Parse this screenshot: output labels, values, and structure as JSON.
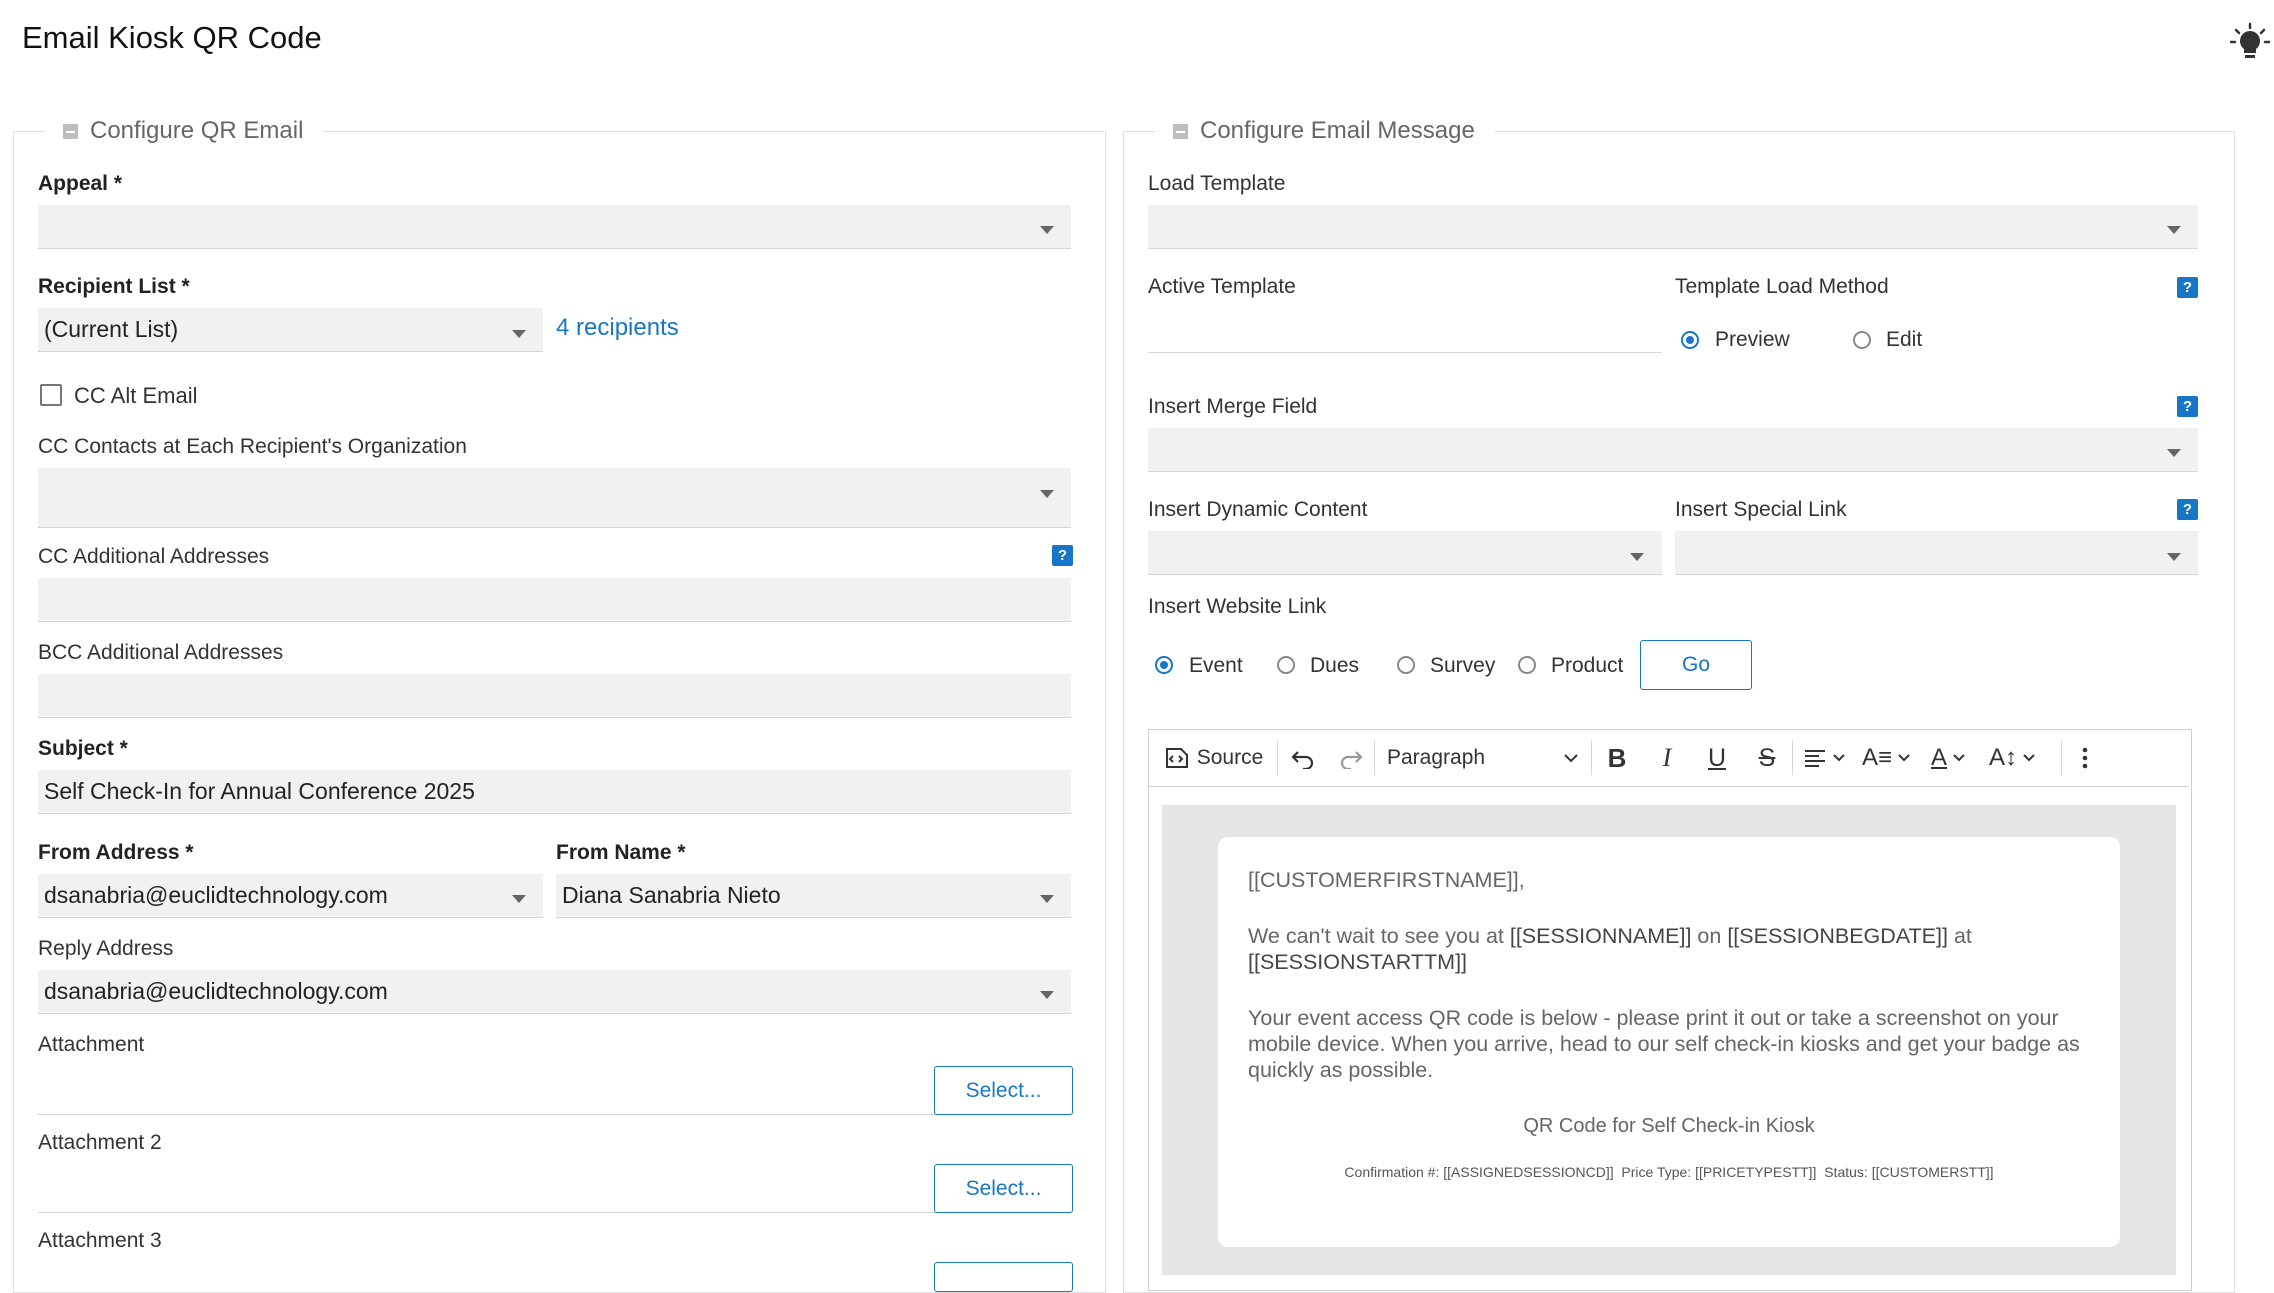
{
  "page": {
    "title": "Email Kiosk QR Code",
    "hint_icon": "lightbulb-icon"
  },
  "left": {
    "section_title": "Configure QR Email",
    "appeal": {
      "label": "Appeal *",
      "value": ""
    },
    "recipient_list": {
      "label": "Recipient List *",
      "value": "(Current List)",
      "recipients_link": "4 recipients"
    },
    "cc_alt_email": {
      "label": "CC Alt Email",
      "checked": false
    },
    "cc_contacts": {
      "label": "CC Contacts at Each Recipient's Organization",
      "value": ""
    },
    "cc_additional": {
      "label": "CC Additional Addresses",
      "value": ""
    },
    "bcc_additional": {
      "label": "BCC Additional Addresses",
      "value": ""
    },
    "subject": {
      "label": "Subject *",
      "value": "Self Check-In for Annual Conference 2025"
    },
    "from_address": {
      "label": "From Address *",
      "value": "dsanabria@euclidtechnology.com"
    },
    "from_name": {
      "label": "From Name *",
      "value": "Diana Sanabria Nieto"
    },
    "reply_address": {
      "label": "Reply Address",
      "value": "dsanabria@euclidtechnology.com"
    },
    "attachment1": {
      "label": "Attachment",
      "button": "Select..."
    },
    "attachment2": {
      "label": "Attachment 2",
      "button": "Select..."
    },
    "attachment3": {
      "label": "Attachment 3"
    }
  },
  "right": {
    "section_title": "Configure Email Message",
    "load_template": {
      "label": "Load Template",
      "value": ""
    },
    "active_template": {
      "label": "Active Template",
      "value": ""
    },
    "template_load_method": {
      "label": "Template Load Method",
      "options": [
        "Preview",
        "Edit"
      ],
      "selected": "Preview"
    },
    "insert_merge_field": {
      "label": "Insert Merge Field",
      "value": ""
    },
    "insert_dynamic_content": {
      "label": "Insert Dynamic Content",
      "value": ""
    },
    "insert_special_link": {
      "label": "Insert Special Link",
      "value": ""
    },
    "insert_website_link": {
      "label": "Insert Website Link",
      "options": [
        "Event",
        "Dues",
        "Survey",
        "Product"
      ],
      "selected": "Event",
      "go_button": "Go"
    },
    "editor": {
      "toolbar": {
        "source_label": "Source",
        "paragraph_label": "Paragraph"
      },
      "content": {
        "greeting": "[[CUSTOMERFIRSTNAME]],",
        "line1_pre": "We can't wait to see you at ",
        "session_name": "[[SESSIONNAME]]",
        "line1_mid": " on ",
        "session_date": "[[SESSIONBEGDATE]]",
        "line1_post": " at",
        "session_time": "[[SESSIONSTARTTM]]",
        "paragraph2": "Your event access QR code is below - please print it out or take a screenshot on your mobile device. When you arrive, head to our self check-in kiosks and get your badge as quickly as possible.",
        "qr_caption": "QR Code for Self Check-in Kiosk",
        "confirmation_label": "Confirmation #:",
        "confirmation_value": "[[ASSIGNEDSESSIONCD]]",
        "price_type_label": "Price Type:",
        "price_type_value": "[[PRICETYPESTT]]",
        "status_label": "Status:",
        "status_value": "[[CUSTOMERSTT]]"
      }
    }
  },
  "colors": {
    "accent": "#1776c8",
    "field_bg": "#f1f1f1",
    "editor_bg": "#e6e6e6"
  }
}
